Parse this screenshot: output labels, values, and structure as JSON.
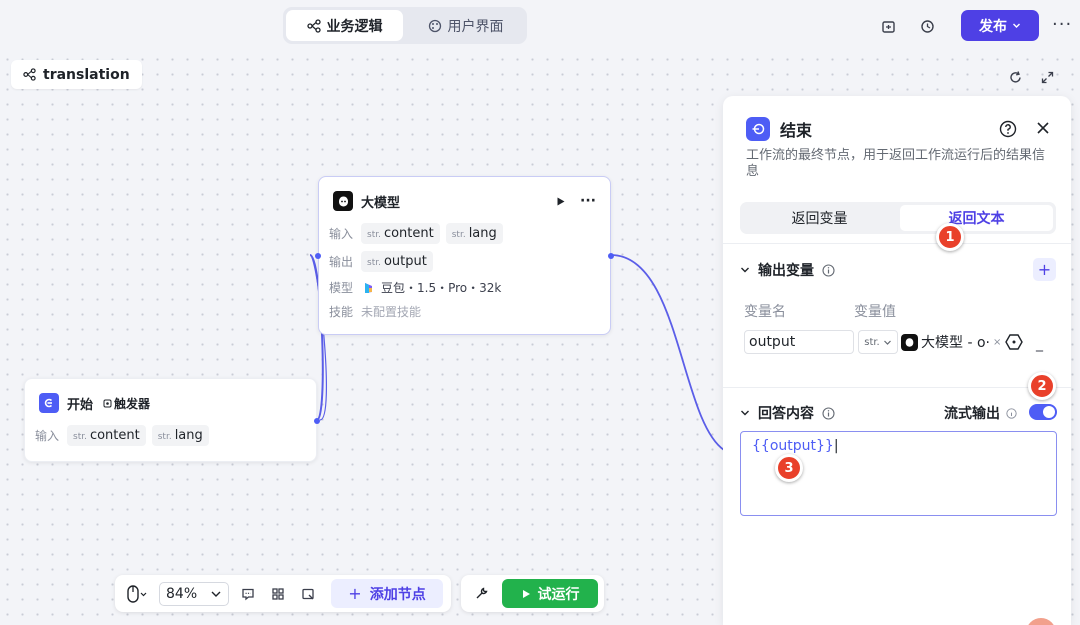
{
  "topbar": {
    "tabs": [
      {
        "label": "业务逻辑",
        "icon": "workflow-icon",
        "active": true
      },
      {
        "label": "用户界面",
        "icon": "palette-icon",
        "active": false
      }
    ],
    "publish_label": "发布"
  },
  "workflow": {
    "name": "translation"
  },
  "nodes": {
    "llm": {
      "title": "大模型",
      "input_label": "输入",
      "inputs": [
        {
          "type": "str.",
          "name": "content"
        },
        {
          "type": "str.",
          "name": "lang"
        }
      ],
      "output_label": "输出",
      "outputs": [
        {
          "type": "str.",
          "name": "output"
        }
      ],
      "model_label": "模型",
      "model_value": "豆包・1.5・Pro・32k",
      "skill_label": "技能",
      "skill_value": "未配置技能"
    },
    "start": {
      "title": "开始",
      "badge": "触发器",
      "input_label": "输入",
      "inputs": [
        {
          "type": "str.",
          "name": "content"
        },
        {
          "type": "str.",
          "name": "lang"
        }
      ]
    }
  },
  "toolbar": {
    "zoom": "84%",
    "add_node_label": "添加节点",
    "run_label": "试运行"
  },
  "panel": {
    "title": "结束",
    "description": "工作流的最终节点，用于返回工作流运行后的结果信息",
    "tabs": [
      {
        "label": "返回变量",
        "active": false
      },
      {
        "label": "返回文本",
        "active": true
      }
    ],
    "output_section": {
      "title": "输出变量",
      "col_name": "变量名",
      "col_value": "变量值",
      "var_name": "output",
      "var_type": "str.",
      "ref_value": "大模型 - o·",
      "dash": "_"
    },
    "answer_section": {
      "title": "回答内容",
      "stream_label": "流式输出",
      "stream_on": true,
      "content": "{{output}}"
    }
  },
  "markers": [
    "1",
    "2",
    "3"
  ],
  "colors": {
    "accent": "#4e40e5",
    "run": "#22b24c",
    "marker": "#e9402a"
  }
}
